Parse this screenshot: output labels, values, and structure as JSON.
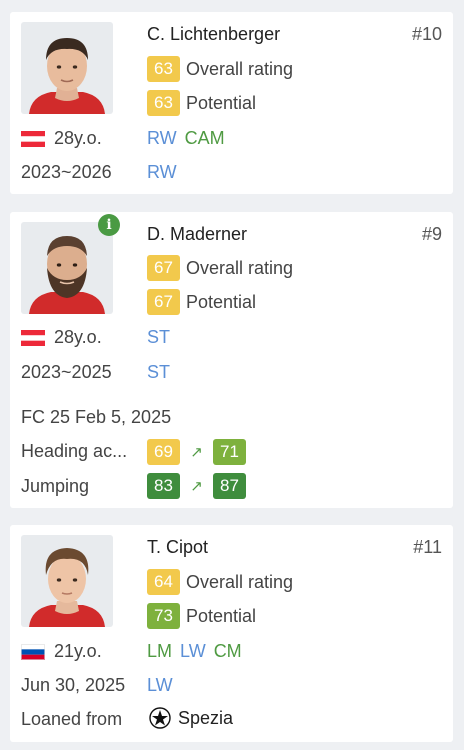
{
  "players": [
    {
      "name": "C. Lichtenberger",
      "number": "#10",
      "overall_value": "63",
      "overall_label": "Overall rating",
      "potential_value": "63",
      "potential_label": "Potential",
      "age": "28y.o.",
      "nationality_flag": "austria-flag",
      "positions": [
        "RW",
        "CAM"
      ],
      "contract": "2023~2026",
      "contract_position": "RW"
    },
    {
      "name": "D. Maderner",
      "number": "#9",
      "overall_value": "67",
      "overall_label": "Overall rating",
      "potential_value": "67",
      "potential_label": "Potential",
      "age": "28y.o.",
      "nationality_flag": "austria-flag",
      "positions": [
        "ST"
      ],
      "contract": "2023~2025",
      "contract_position": "ST",
      "info_icon": "info-icon",
      "fc_date": "FC 25 Feb 5, 2025",
      "attribute_changes": [
        {
          "label": "Heading ac...",
          "from": "69",
          "to": "71"
        },
        {
          "label": "Jumping",
          "from": "83",
          "to": "87"
        }
      ]
    },
    {
      "name": "T. Cipot",
      "number": "#11",
      "overall_value": "64",
      "overall_label": "Overall rating",
      "potential_value": "73",
      "potential_label": "Potential",
      "age": "21y.o.",
      "nationality_flag": "slovenia-flag",
      "positions": [
        "LM",
        "LW",
        "CM"
      ],
      "contract": "Jun 30, 2025",
      "contract_position": "LW",
      "loan_label": "Loaned from",
      "loan_club": "Spezia"
    }
  ],
  "colors": {
    "rating_yellow": "#f2c94c",
    "rating_lime": "#7eb13d",
    "rating_green": "#3f8d3d",
    "position_blue": "#5b8fd6",
    "position_green": "#4f9a42",
    "austria_red": "#ed2939",
    "slovenia_blue": "#0052b4",
    "slovenia_red": "#d80027"
  },
  "icons": {
    "up_arrow": "↗"
  }
}
